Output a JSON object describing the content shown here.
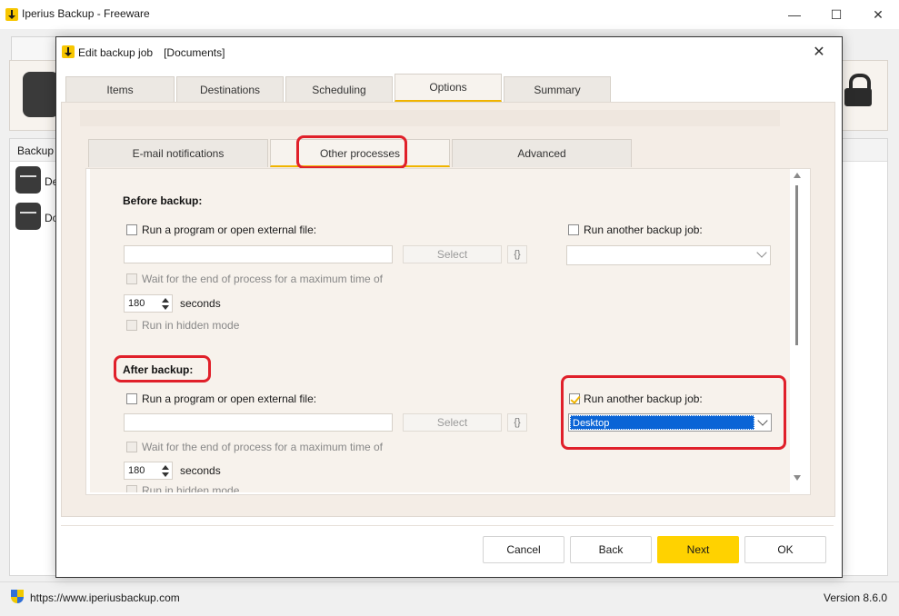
{
  "main_window": {
    "title": "Iperius Backup - Freeware",
    "controls": {
      "minimize": "—",
      "maximize": "☐",
      "close": "✕"
    },
    "list_header": "Backup jo",
    "jobs": [
      {
        "label": "De"
      },
      {
        "label": "Do"
      }
    ],
    "status_url": "https://www.iperiusbackup.com",
    "version": "Version 8.6.0"
  },
  "dialog": {
    "title": "Edit backup job",
    "job_name": "[Documents]",
    "close_glyph": "✕",
    "tabs": [
      "Items",
      "Destinations",
      "Scheduling",
      "Options",
      "Summary"
    ],
    "active_tab": "Options",
    "subtabs": [
      "E-mail notifications",
      "Other processes",
      "Advanced"
    ],
    "active_subtab": "Other processes",
    "before": {
      "title": "Before backup:",
      "run_program_label": "Run a program or open external file:",
      "program_path": "",
      "select_label": "Select",
      "braces_label": "{}",
      "wait_label": "Wait for the end of process for a maximum time of",
      "wait_seconds": "180",
      "seconds_label": "seconds",
      "hidden_label": "Run in hidden mode",
      "run_job_label": "Run another backup job:",
      "run_job_value": ""
    },
    "after": {
      "title": "After backup:",
      "run_program_label": "Run a program or open external file:",
      "program_path": "",
      "select_label": "Select",
      "braces_label": "{}",
      "wait_label": "Wait for the end of process for a maximum time of",
      "wait_seconds": "180",
      "seconds_label": "seconds",
      "hidden_label": "Run in hidden mode",
      "run_job_label": "Run another backup job:",
      "run_job_checked": true,
      "run_job_value": "Desktop"
    },
    "buttons": {
      "cancel": "Cancel",
      "back": "Back",
      "next": "Next",
      "ok": "OK"
    },
    "colors": {
      "accent": "#f0b400",
      "primary_button": "#ffd200",
      "highlight": "#e0202a",
      "selection": "#0a64d6"
    }
  }
}
